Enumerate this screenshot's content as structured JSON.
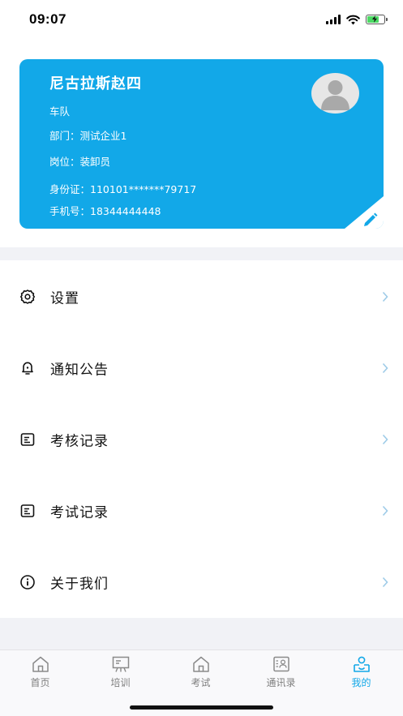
{
  "status_bar": {
    "time": "09:07"
  },
  "profile": {
    "name": "尼古拉斯赵四",
    "team": "车队",
    "department_label": "部门：",
    "department": "测试企业1",
    "position_label": "岗位：",
    "position": "装卸员",
    "id_label": "身份证：",
    "id_number": "110101*******79717",
    "phone_label": "手机号：",
    "phone": "18344444448",
    "card_color": "#12a8e8"
  },
  "menu": {
    "items": [
      {
        "label": "设置",
        "icon": "gear-icon"
      },
      {
        "label": "通知公告",
        "icon": "bell-icon"
      },
      {
        "label": "考核记录",
        "icon": "document-icon"
      },
      {
        "label": "考试记录",
        "icon": "document-icon"
      },
      {
        "label": "关于我们",
        "icon": "info-icon"
      }
    ]
  },
  "tabbar": {
    "tabs": [
      {
        "label": "首页",
        "icon": "home-icon",
        "active": false
      },
      {
        "label": "培训",
        "icon": "training-board-icon",
        "active": false
      },
      {
        "label": "考试",
        "icon": "exam-icon",
        "active": false
      },
      {
        "label": "通讯录",
        "icon": "contacts-icon",
        "active": false
      },
      {
        "label": "我的",
        "icon": "profile-icon",
        "active": true
      }
    ],
    "active_color": "#12a8e8",
    "inactive_color": "#7f7f7f"
  }
}
